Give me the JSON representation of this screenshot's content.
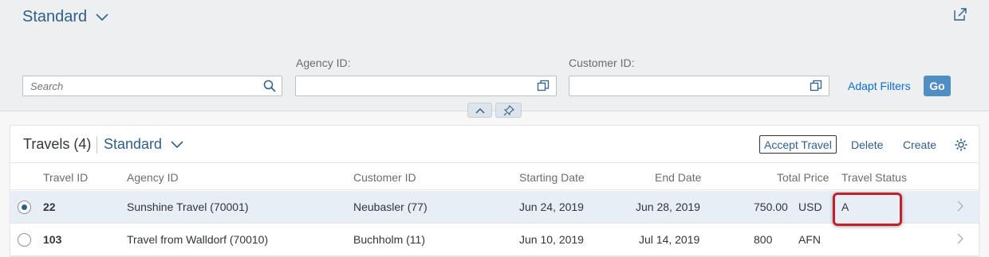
{
  "header": {
    "variant_label": "Standard",
    "search": {
      "placeholder": "Search",
      "value": ""
    },
    "agency_id": {
      "label": "Agency ID:",
      "value": ""
    },
    "customer_id": {
      "label": "Customer ID:",
      "value": ""
    },
    "adapt_filters_label": "Adapt Filters",
    "go_label": "Go"
  },
  "table": {
    "title": "Travels (4)",
    "variant_label": "Standard",
    "toolbar": {
      "accept_label": "Accept Travel",
      "delete_label": "Delete",
      "create_label": "Create"
    },
    "columns": {
      "travel_id": "Travel ID",
      "agency_id": "Agency ID",
      "customer_id": "Customer ID",
      "starting_date": "Starting Date",
      "end_date": "End Date",
      "total_price": "Total Price",
      "travel_status": "Travel Status"
    },
    "rows": [
      {
        "travel_id": "22",
        "agency": "Sunshine Travel (70001)",
        "customer": "Neubasler (77)",
        "start": "Jun 24, 2019",
        "end": "Jun 28, 2019",
        "price": "750.00",
        "currency": "USD",
        "status": "A",
        "selected": true
      },
      {
        "travel_id": "103",
        "agency": "Travel from Walldorf (70010)",
        "customer": "Buchholm (11)",
        "start": "Jun 10, 2019",
        "end": "Jul 14, 2019",
        "price": "800",
        "currency": "AFN",
        "status": "",
        "selected": false
      }
    ]
  },
  "colors": {
    "accent": "#0a6ed1",
    "highlight": "#c2212b",
    "selected_row": "#e8eef5"
  },
  "icons": [
    "chevron-down-icon",
    "share-icon",
    "search-icon",
    "value-help-icon",
    "collapse-icon",
    "pin-icon",
    "settings-icon",
    "navigation-arrow-icon"
  ]
}
